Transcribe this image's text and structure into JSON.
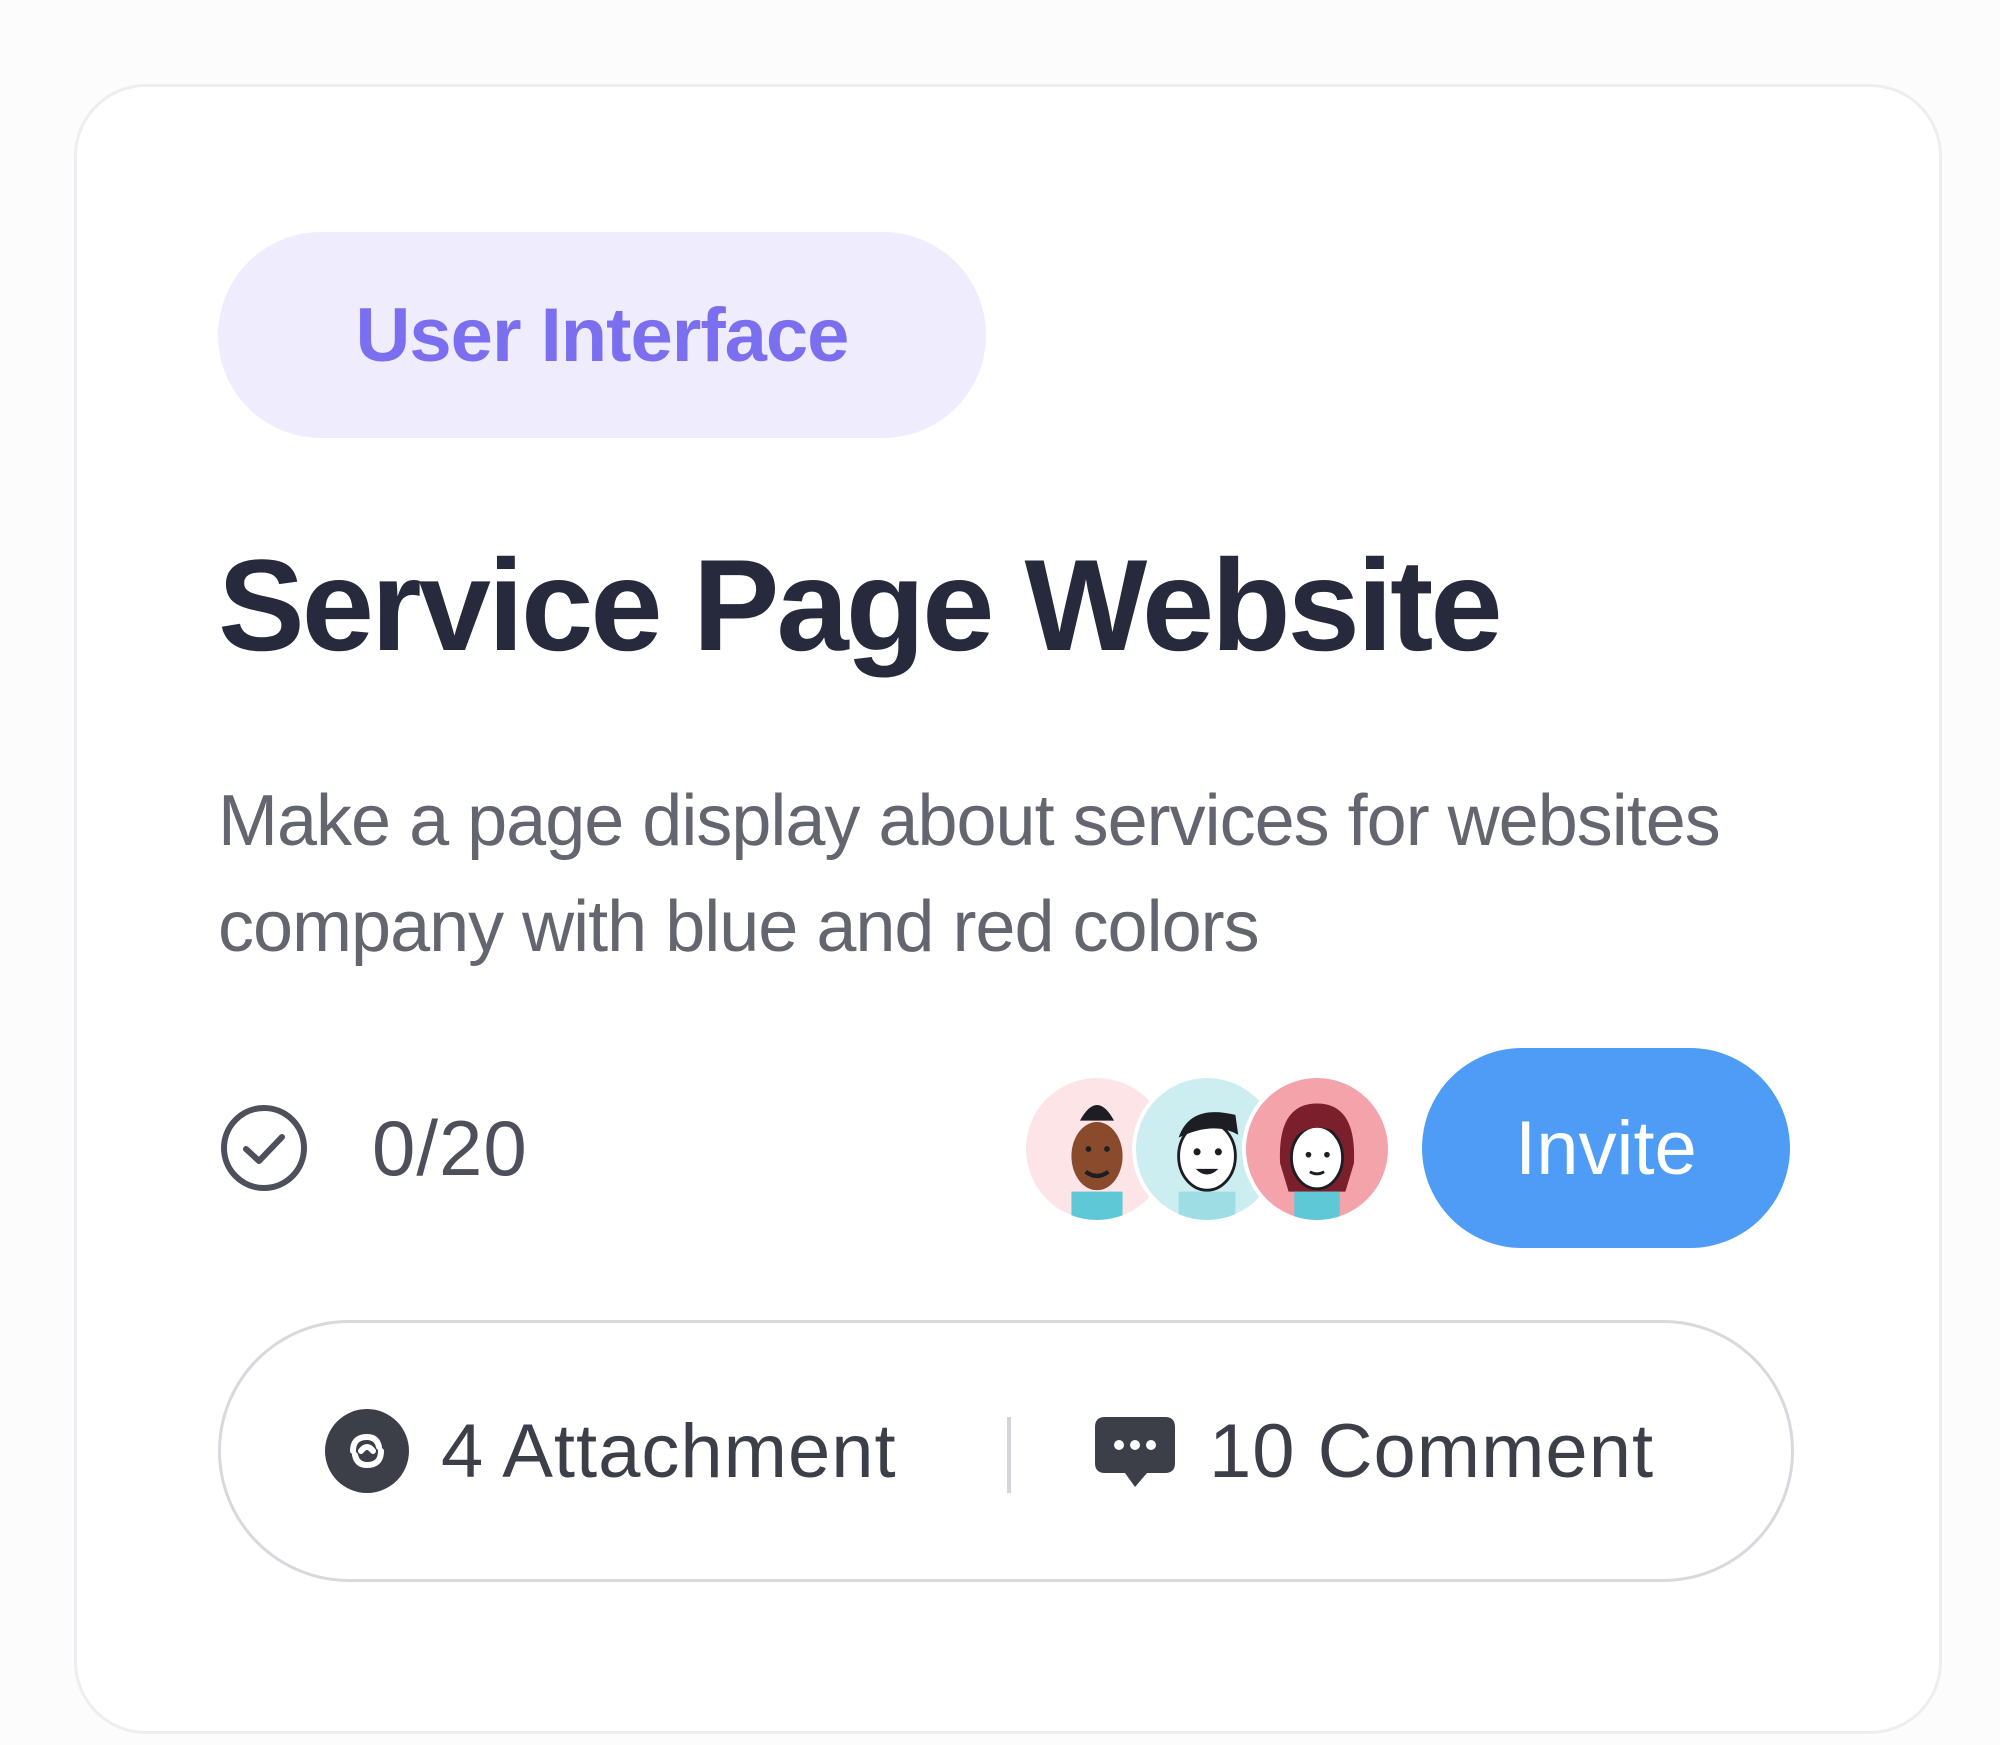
{
  "card": {
    "tag": "User Interface",
    "title": "Service Page Website",
    "description": "Make a page display about services for websites company with blue and red colors",
    "progress": "0/20",
    "invite_label": "Invite",
    "attachment_label": "4 Attachment",
    "comment_label": "10 Comment"
  },
  "icons": {
    "progress": "check-circle-icon",
    "attachment": "attachment-link-icon",
    "comment": "chat-bubble-icon"
  },
  "colors": {
    "tag_bg": "#efedfd",
    "tag_text": "#7b6ff0",
    "title": "#262a3c",
    "invite_bg": "#4f9cf6",
    "avatar_bg_1": "#fde4e6",
    "avatar_bg_2": "#cdeef0",
    "avatar_bg_3": "#f4a3aa"
  }
}
